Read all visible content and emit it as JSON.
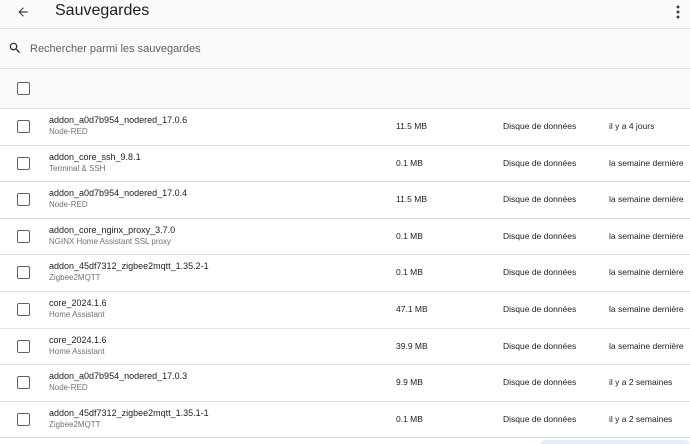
{
  "header": {
    "title": "Sauvegardes"
  },
  "search": {
    "placeholder": "Rechercher parmi les sauvegardes"
  },
  "backups": [
    {
      "name": "addon_a0d7b954_nodered_17.0.6",
      "addon": "Node-RED",
      "size": "11.5 MB",
      "location": "Disque de données",
      "date": "il y a 4 jours"
    },
    {
      "name": "addon_core_ssh_9.8.1",
      "addon": "Terminal & SSH",
      "size": "0.1 MB",
      "location": "Disque de données",
      "date": "la semaine dernière"
    },
    {
      "name": "addon_a0d7b954_nodered_17.0.4",
      "addon": "Node-RED",
      "size": "11.5 MB",
      "location": "Disque de données",
      "date": "la semaine dernière"
    },
    {
      "name": "addon_core_nginx_proxy_3.7.0",
      "addon": "NGINX Home Assistant SSL proxy",
      "size": "0.1 MB",
      "location": "Disque de données",
      "date": "la semaine dernière"
    },
    {
      "name": "addon_45df7312_zigbee2mqtt_1.35.2-1",
      "addon": "Zigbee2MQTT",
      "size": "0.1 MB",
      "location": "Disque de données",
      "date": "la semaine dernière"
    },
    {
      "name": "core_2024.1.6",
      "addon": "Home Assistant",
      "size": "47.1 MB",
      "location": "Disque de données",
      "date": "la semaine dernière"
    },
    {
      "name": "core_2024.1.6",
      "addon": "Home Assistant",
      "size": "39.9 MB",
      "location": "Disque de données",
      "date": "la semaine dernière"
    },
    {
      "name": "addon_a0d7b954_nodered_17.0.3",
      "addon": "Node-RED",
      "size": "9.9 MB",
      "location": "Disque de données",
      "date": "il y a 2 semaines"
    },
    {
      "name": "addon_45df7312_zigbee2mqtt_1.35.1-1",
      "addon": "Zigbee2MQTT",
      "size": "0.1 MB",
      "location": "Disque de données",
      "date": "il y a 2 semaines"
    }
  ],
  "icons": {
    "back": "arrow-left-icon",
    "menu": "dots-vertical-icon",
    "search": "search-icon"
  }
}
